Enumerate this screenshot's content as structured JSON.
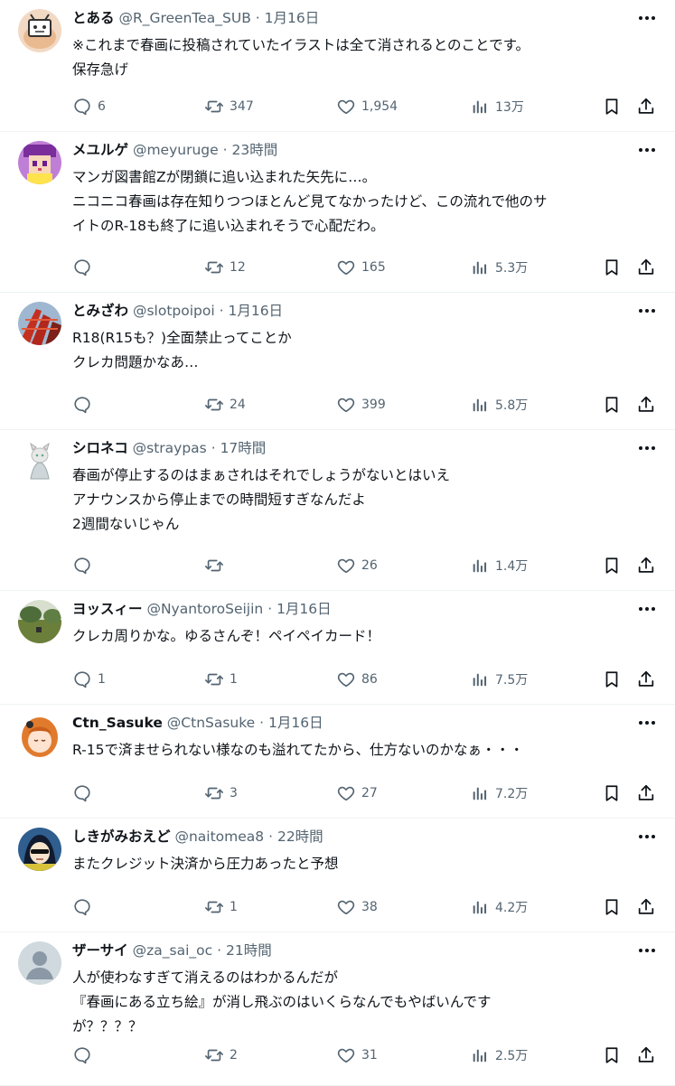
{
  "tweets": [
    {
      "avatar_icon": "niconico-tv-avatar",
      "name": "とある",
      "handle": "@R_GreenTea_SUB",
      "sep": "·",
      "time": "1月16日",
      "lines": [
        "※これまで春画に投稿されていたイラストは全て消されるとのことです。",
        "保存急げ"
      ],
      "replies": "6",
      "retweets": "347",
      "likes": "1,954",
      "views": "13万"
    },
    {
      "avatar_icon": "purple-pixel-character-avatar",
      "name": "メユルゲ",
      "handle": "@meyuruge",
      "sep": "·",
      "time": "23時間",
      "lines": [
        "マンガ図書館Zが閉鎖に追い込まれた矢先に…。",
        "ニコニコ春画は存在知りつつほとんど見てなかったけど、この流れで他のサ",
        "イトのR-18も終了に追い込まれそうで心配だわ。"
      ],
      "replies": "",
      "retweets": "12",
      "likes": "165",
      "views": "5.3万"
    },
    {
      "avatar_icon": "red-building-photo-avatar",
      "name": "とみざわ",
      "handle": "@slotpoipoi",
      "sep": "·",
      "time": "1月16日",
      "lines": [
        "R18(R15も？)全面禁止ってことか",
        "クレカ問題かなあ…"
      ],
      "replies": "",
      "retweets": "24",
      "likes": "399",
      "views": "5.8万"
    },
    {
      "avatar_icon": "white-cat-girl-avatar",
      "name": "シロネコ",
      "handle": "@straypas",
      "sep": "·",
      "time": "17時間",
      "lines": [
        "春画が停止するのはまぁされはそれでしょうがないとはいえ",
        "アナウンスから停止までの時間短すぎなんだよ",
        "2週間ないじゃん"
      ],
      "replies": "",
      "retweets": "",
      "likes": "26",
      "views": "1.4万"
    },
    {
      "avatar_icon": "landscape-photo-avatar",
      "name": "ヨッスィー",
      "handle": "@NyantoroSeijin",
      "sep": "·",
      "time": "1月16日",
      "lines": [
        "クレカ周りかな。ゆるさんぞ！ペイペイカード！"
      ],
      "replies": "1",
      "retweets": "1",
      "likes": "86",
      "views": "7.5万"
    },
    {
      "avatar_icon": "orange-hair-girl-avatar",
      "name": "Ctn_Sasuke",
      "handle": "@CtnSasuke",
      "sep": "·",
      "time": "1月16日",
      "lines": [
        "R-15で済ませられない様なのも溢れてたから、仕方ないのかなぁ・・・"
      ],
      "replies": "",
      "retweets": "3",
      "likes": "27",
      "views": "7.2万"
    },
    {
      "avatar_icon": "sunglasses-character-avatar",
      "name": "しきがみおえど",
      "handle": "@naitomea8",
      "sep": "·",
      "time": "22時間",
      "lines": [
        "またクレジット決済から圧力あったと予想"
      ],
      "replies": "",
      "retweets": "1",
      "likes": "38",
      "views": "4.2万"
    },
    {
      "avatar_icon": "default-user-avatar",
      "name": "ザーサイ",
      "handle": "@za_sai_oc",
      "sep": "·",
      "time": "21時間",
      "lines": [
        "人が使わなすぎて消えるのはわかるんだが",
        "『春画にある立ち絵』が消し飛ぶのはいくらなんでもやばいんです",
        "が？？？？"
      ],
      "replies": "",
      "retweets": "2",
      "likes": "31",
      "views": "2.5万"
    }
  ],
  "colors": {
    "text": "#0f1419",
    "muted": "#536471",
    "divider": "#eff3f4"
  }
}
